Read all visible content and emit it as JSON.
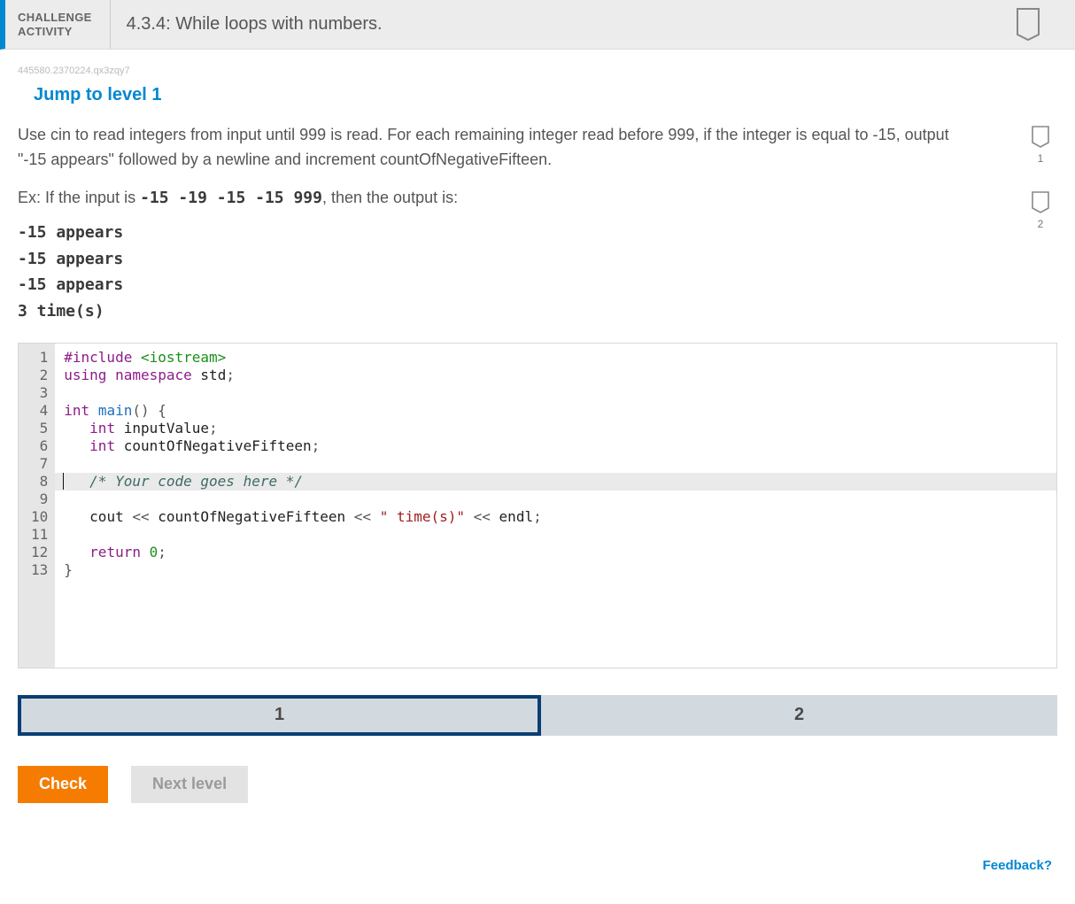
{
  "header": {
    "kicker_line1": "CHALLENGE",
    "kicker_line2": "ACTIVITY",
    "title": "4.3.4: While loops with numbers."
  },
  "meta": {
    "qid": "445580.2370224.qx3zqy7",
    "jump_label": "Jump to level 1"
  },
  "levels_rail": {
    "items": [
      {
        "number": "1"
      },
      {
        "number": "2"
      }
    ]
  },
  "prompt": "Use cin to read integers from input until 999 is read. For each remaining integer read before 999, if the integer is equal to -15, output \"-15 appears\" followed by a newline and increment countOfNegativeFifteen.",
  "example": {
    "prefix": "Ex: If the input is ",
    "input": "-15 -19 -15 -15 999",
    "suffix": ", then the output is:"
  },
  "output_block": "-15 appears\n-15 appears\n-15 appears\n3 time(s)",
  "code": {
    "line_count": 13,
    "highlight_line": 8,
    "lines": [
      {
        "tokens": [
          [
            "kw",
            "#include"
          ],
          [
            "pun",
            " "
          ],
          [
            "hdrinc",
            "<iostream>"
          ]
        ]
      },
      {
        "tokens": [
          [
            "kw",
            "using"
          ],
          [
            "pun",
            " "
          ],
          [
            "ns",
            "namespace"
          ],
          [
            "pun",
            " "
          ],
          [
            "id",
            "std"
          ],
          [
            "pun",
            ";"
          ]
        ]
      },
      {
        "tokens": []
      },
      {
        "tokens": [
          [
            "ty",
            "int"
          ],
          [
            "pun",
            " "
          ],
          [
            "fn",
            "main"
          ],
          [
            "pun",
            "()"
          ],
          [
            "pun",
            " {"
          ]
        ]
      },
      {
        "tokens": [
          [
            "pun",
            "   "
          ],
          [
            "ty",
            "int"
          ],
          [
            "pun",
            " "
          ],
          [
            "id",
            "inputValue"
          ],
          [
            "pun",
            ";"
          ]
        ]
      },
      {
        "tokens": [
          [
            "pun",
            "   "
          ],
          [
            "ty",
            "int"
          ],
          [
            "pun",
            " "
          ],
          [
            "id",
            "countOfNegativeFifteen"
          ],
          [
            "pun",
            ";"
          ]
        ]
      },
      {
        "tokens": []
      },
      {
        "tokens": [
          [
            "pun",
            "   "
          ],
          [
            "cmt",
            "/* Your code goes here */"
          ]
        ],
        "caret_after": 0
      },
      {
        "tokens": []
      },
      {
        "tokens": [
          [
            "pun",
            "   "
          ],
          [
            "id",
            "cout"
          ],
          [
            "pun",
            " << "
          ],
          [
            "id",
            "countOfNegativeFifteen"
          ],
          [
            "pun",
            " << "
          ],
          [
            "str",
            "\" time(s)\""
          ],
          [
            "pun",
            " << "
          ],
          [
            "id",
            "endl"
          ],
          [
            "pun",
            ";"
          ]
        ]
      },
      {
        "tokens": []
      },
      {
        "tokens": [
          [
            "pun",
            "   "
          ],
          [
            "kw",
            "return"
          ],
          [
            "pun",
            " "
          ],
          [
            "num",
            "0"
          ],
          [
            "pun",
            ";"
          ]
        ]
      },
      {
        "tokens": [
          [
            "pun",
            "}"
          ]
        ]
      }
    ]
  },
  "level_tabs": [
    {
      "label": "1",
      "active": true
    },
    {
      "label": "2",
      "active": false
    }
  ],
  "buttons": {
    "check": "Check",
    "next": "Next level"
  },
  "feedback_label": "Feedback?"
}
